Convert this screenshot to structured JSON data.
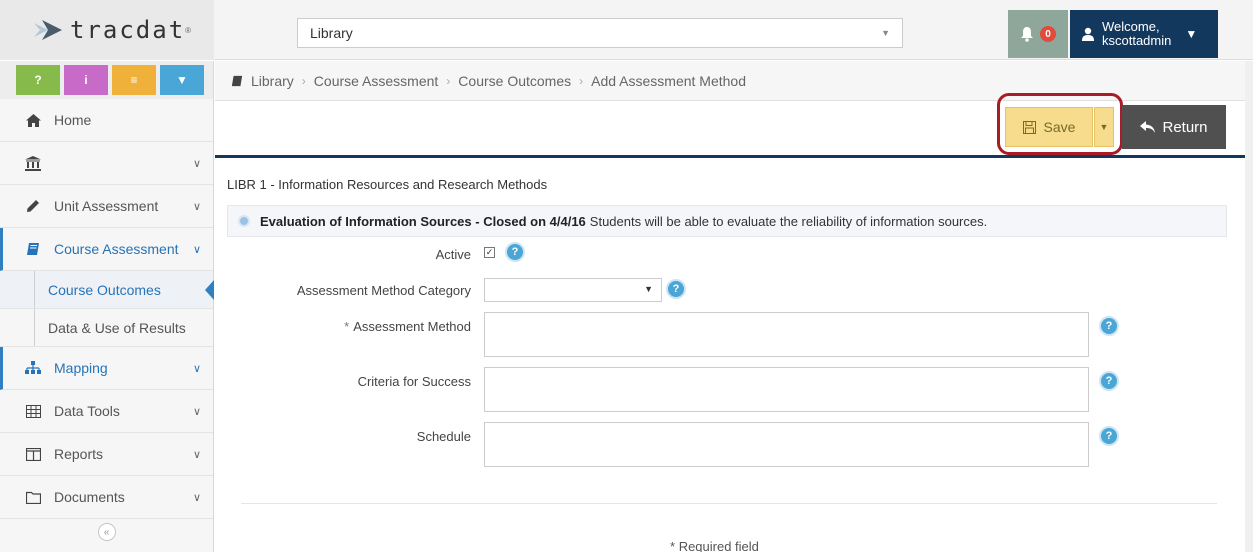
{
  "app": {
    "logo_text": "tracdat",
    "logo_tm": "®"
  },
  "header": {
    "library_select": "Library",
    "notifications_count": "0",
    "welcome": "Welcome,",
    "username": "kscottadmin"
  },
  "quick_buttons": [
    "?",
    "i",
    "≡",
    "▼"
  ],
  "sidebar": {
    "items": [
      {
        "label": "Home",
        "icon": "home-icon"
      },
      {
        "label": "",
        "icon": "institution-icon"
      },
      {
        "label": "Unit Assessment",
        "icon": "pencil-icon"
      },
      {
        "label": "Course Assessment",
        "icon": "book-icon"
      },
      {
        "label": "Mapping",
        "icon": "sitemap-icon"
      },
      {
        "label": "Data Tools",
        "icon": "table-icon"
      },
      {
        "label": "Reports",
        "icon": "columns-icon"
      },
      {
        "label": "Documents",
        "icon": "folder-icon"
      }
    ],
    "sub_items": [
      "Course Outcomes",
      "Data & Use of Results"
    ]
  },
  "breadcrumb": [
    "Library",
    "Course Assessment",
    "Course Outcomes",
    "Add Assessment Method"
  ],
  "toolbar": {
    "save_label": "Save",
    "return_label": "Return"
  },
  "form": {
    "outcome_title": "LIBR 1 - Information Resources and Research Methods",
    "outcome_name": "Evaluation of Information Sources - Closed on 4/4/16",
    "outcome_desc": "Students will be able to evaluate the reliability of information sources.",
    "active_label": "Active",
    "active_checked": true,
    "category_label": "Assessment Method Category",
    "category_value": "",
    "method_label": "Assessment Method",
    "criteria_label": "Criteria for Success",
    "schedule_label": "Schedule",
    "required_star": "*",
    "required_note": "Required field"
  },
  "colors": {
    "brand_navy": "#13385e",
    "accent_blue": "#2673b8",
    "save_yellow": "#f6dc8c",
    "highlight_red": "#a81c26"
  }
}
